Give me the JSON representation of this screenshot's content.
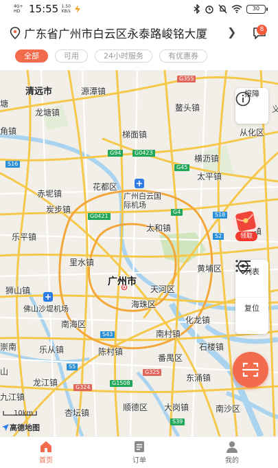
{
  "status_bar": {
    "network": "4G+ HD",
    "time": "15:55",
    "speed_value": "1.50",
    "speed_unit": "KB/s",
    "battery": "30"
  },
  "header": {
    "address": "广东省广州市白云区永泰路峻铭大厦",
    "message_badge": "8",
    "icons": [
      "location-pin-icon",
      "chevron-right-icon",
      "message-icon"
    ]
  },
  "filters": [
    {
      "label": "全部",
      "active": true
    },
    {
      "label": "可用",
      "active": false
    },
    {
      "label": "24小时服务",
      "active": false
    },
    {
      "label": "有优惠券",
      "active": false
    }
  ],
  "map": {
    "places": {
      "qingyuan": "清远市",
      "yuantan": "源潭镇",
      "longtang": "龙塘镇",
      "aotou": "鳌头镇",
      "tang": "塘",
      "jiao": "角镇",
      "tiqiao": "梯面镇",
      "conghua": "从化区",
      "huadu": "花都区",
      "chini": "赤坭镇",
      "baiyun_airport": "广州白云国际机场",
      "taiping": "太平镇",
      "tanbu": "炭步镇",
      "taihe": "太和镇",
      "xinlong": "新龙镇",
      "leping": "乐平镇",
      "lishui": "里水镇",
      "huangpu": "黄埔区",
      "guangzhou": "广州市",
      "tianhe": "天河区",
      "shishan": "狮山镇",
      "haizhu": "海珠区",
      "foshan_airport": "佛山沙堤机场",
      "nanhai": "南海区",
      "nancun": "南村镇",
      "huadong": "化龙镇",
      "lecong": "乐从镇",
      "chencun": "陈村镇",
      "panyu": "番禺区",
      "shilou": "石楼镇",
      "dongchong": "东涌镇",
      "longjiang": "龙江镇",
      "shunde": "顺德区",
      "dagang": "大岗镇",
      "nansha": "南沙区",
      "jiujiang": "九江镇",
      "xingtan": "杏坛镇",
      "hengli": "横沥镇",
      "kaiping": "崇南",
      "shan": "山",
      "yi": "义"
    },
    "route_badges": [
      "G355",
      "G94",
      "G0423",
      "G45",
      "S16",
      "S18",
      "G4",
      "G0421",
      "S2",
      "S43",
      "S5",
      "G1508",
      "G324",
      "G325",
      "S39"
    ],
    "scale": "10km",
    "logo": "高德地图"
  },
  "map_controls": {
    "report_label": "报障",
    "promo_label": "领取",
    "list_label": "列表",
    "locate_label": "复位"
  },
  "tabs": [
    {
      "label": "首页",
      "active": true,
      "icon": "home-icon"
    },
    {
      "label": "订单",
      "active": false,
      "icon": "orders-icon"
    },
    {
      "label": "我的",
      "active": false,
      "icon": "profile-icon"
    }
  ],
  "colors": {
    "accent": "#f26b4c",
    "badge": "#f25a3a",
    "road_major": "#f6c84a",
    "water": "#a9d3ee",
    "park": "#cfe6bf"
  }
}
